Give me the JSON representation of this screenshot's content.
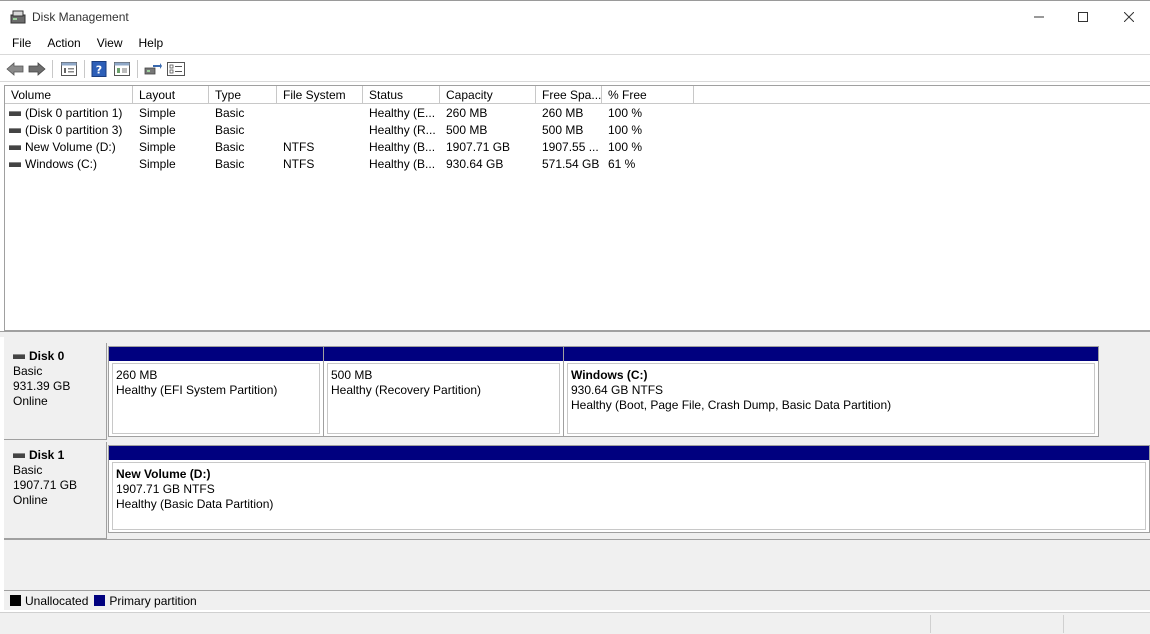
{
  "window": {
    "title": "Disk Management"
  },
  "menu": {
    "items": [
      "File",
      "Action",
      "View",
      "Help"
    ]
  },
  "toolbar": {
    "buttons": [
      "back-icon",
      "forward-icon",
      "disk-list-icon",
      "help-icon",
      "properties-icon",
      "rescan-icon",
      "settings-icon"
    ]
  },
  "volume_list": {
    "columns": [
      "Volume",
      "Layout",
      "Type",
      "File System",
      "Status",
      "Capacity",
      "Free Spa...",
      "% Free"
    ],
    "rows": [
      {
        "volume": "(Disk 0 partition 1)",
        "layout": "Simple",
        "type": "Basic",
        "fs": "",
        "status": "Healthy (E...",
        "capacity": "260 MB",
        "free": "260 MB",
        "pct": "100 %"
      },
      {
        "volume": "(Disk 0 partition 3)",
        "layout": "Simple",
        "type": "Basic",
        "fs": "",
        "status": "Healthy (R...",
        "capacity": "500 MB",
        "free": "500 MB",
        "pct": "100 %"
      },
      {
        "volume": "New Volume (D:)",
        "layout": "Simple",
        "type": "Basic",
        "fs": "NTFS",
        "status": "Healthy (B...",
        "capacity": "1907.71 GB",
        "free": "1907.55 ...",
        "pct": "100 %"
      },
      {
        "volume": "Windows (C:)",
        "layout": "Simple",
        "type": "Basic",
        "fs": "NTFS",
        "status": "Healthy (B...",
        "capacity": "930.64 GB",
        "free": "571.54 GB",
        "pct": "61 %"
      }
    ]
  },
  "disks": [
    {
      "name": "Disk 0",
      "kind": "Basic",
      "size": "931.39 GB",
      "state": "Online",
      "partitions": [
        {
          "title": "",
          "line1": "260 MB",
          "line2": "Healthy (EFI System Partition)"
        },
        {
          "title": "",
          "line1": "500 MB",
          "line2": "Healthy (Recovery Partition)"
        },
        {
          "title": "Windows  (C:)",
          "line1": "930.64 GB NTFS",
          "line2": "Healthy (Boot, Page File, Crash Dump, Basic Data Partition)"
        }
      ]
    },
    {
      "name": "Disk 1",
      "kind": "Basic",
      "size": "1907.71 GB",
      "state": "Online",
      "partitions": [
        {
          "title": "New Volume  (D:)",
          "line1": "1907.71 GB NTFS",
          "line2": "Healthy (Basic Data Partition)"
        }
      ]
    }
  ],
  "legend": {
    "unallocated": {
      "label": "Unallocated",
      "color": "#000000"
    },
    "primary": {
      "label": "Primary partition",
      "color": "#00007f"
    }
  }
}
